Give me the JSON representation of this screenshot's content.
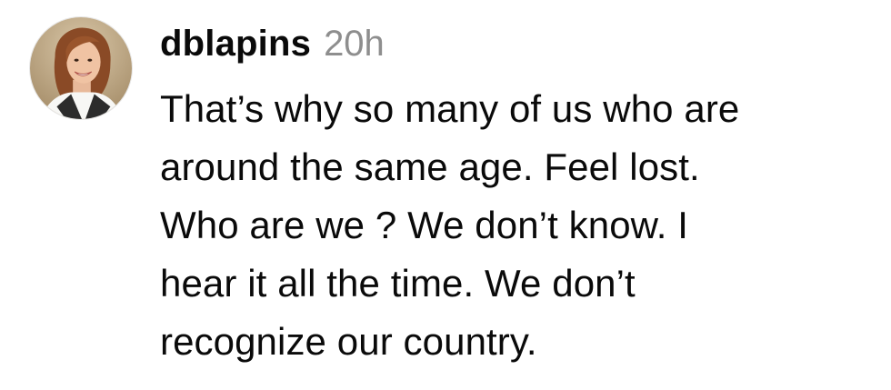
{
  "comment": {
    "username": "dblapins",
    "timestamp": "20h",
    "avatar_icon": "user-avatar-photo",
    "text": "That’s why so many of us who are\naround the same age. Feel lost.\nWho are we ? We don’t know. I\nhear it all the time. We don’t\nrecognize our country."
  },
  "colors": {
    "text": "#0a0a0a",
    "timestamp": "#8e8e8e",
    "background": "#ffffff"
  }
}
